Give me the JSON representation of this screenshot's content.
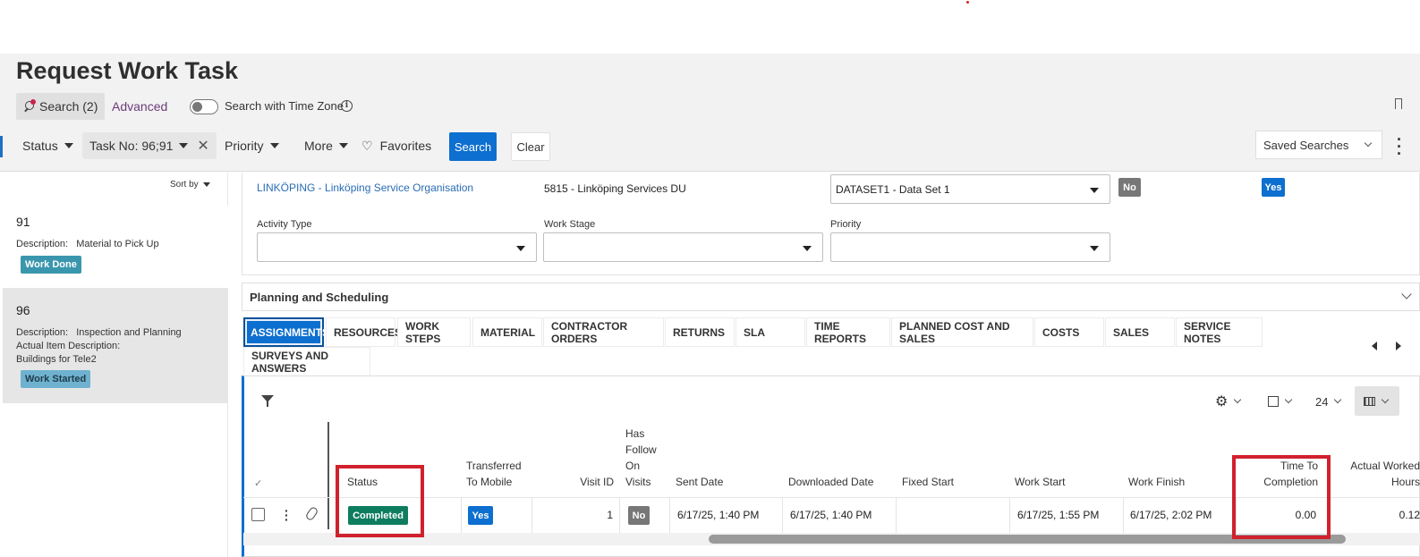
{
  "page": {
    "title": "Request Work Task"
  },
  "search_tabs": {
    "search_label": "Search (2)",
    "advanced_label": "Advanced"
  },
  "time_zone": {
    "label": "Search with Time Zone",
    "enabled": false
  },
  "filters": {
    "status_label": "Status",
    "task_chip": "Task No: 96;91",
    "priority_label": "Priority",
    "more_label": "More",
    "favorites_label": "Favorites",
    "search_button": "Search",
    "clear_button": "Clear",
    "saved_searches": "Saved Searches"
  },
  "sidebar": {
    "sort_label": "Sort by",
    "cards": [
      {
        "id": "91",
        "desc_label": "Description:",
        "desc_value": "Material to Pick Up",
        "status": "Work Done"
      },
      {
        "id": "96",
        "desc_label": "Description:",
        "desc_value": "Inspection and Planning",
        "actual_label": "Actual Item Description:",
        "actual_value": "Buildings for Tele2",
        "status": "Work Started"
      }
    ]
  },
  "form": {
    "org_link": "LINKÖPING - Linköping Service Organisation",
    "du_value": "5815 - Linköping Services DU",
    "dataset_value": "DATASET1 - Data Set 1",
    "pill_no": "No",
    "pill_yes": "Yes",
    "activity_type_label": "Activity Type",
    "work_stage_label": "Work Stage",
    "priority_label": "Priority"
  },
  "section": {
    "title": "Planning and Scheduling"
  },
  "tabs": [
    "ASSIGNMENTS",
    "RESOURCES",
    "WORK STEPS",
    "MATERIAL",
    "CONTRACTOR ORDERS",
    "RETURNS",
    "SLA",
    "TIME REPORTS",
    "PLANNED COST AND SALES",
    "COSTS",
    "SALES",
    "SERVICE NOTES",
    "SURVEYS AND ANSWERS"
  ],
  "grid_toolbar": {
    "page_size": "24"
  },
  "table": {
    "headers": {
      "status": "Status",
      "transferred_1": "Transferred",
      "transferred_2": "To Mobile",
      "visit_id": "Visit ID",
      "follow_1": "Has",
      "follow_2": "Follow",
      "follow_3": "On",
      "follow_4": "Visits",
      "sent_date": "Sent Date",
      "downloaded_date": "Downloaded Date",
      "fixed_start": "Fixed Start",
      "work_start": "Work Start",
      "work_finish": "Work Finish",
      "ttc_1": "Time To",
      "ttc_2": "Completion",
      "awh_1": "Actual Worked",
      "awh_2": "Hours"
    },
    "row": {
      "status": "Completed",
      "transferred": "Yes",
      "visit_id": "1",
      "has_follow": "No",
      "sent_date": "6/17/25, 1:40 PM",
      "downloaded_date": "6/17/25, 1:40 PM",
      "fixed_start": "",
      "work_start": "6/17/25, 1:55 PM",
      "work_finish": "6/17/25, 2:02 PM",
      "time_to_completion": "0.00",
      "actual_worked_hours": "0.12"
    }
  },
  "colors": {
    "accent": "#0d6fcf",
    "completed": "#0e7d5f",
    "highlight": "#d0212d"
  }
}
